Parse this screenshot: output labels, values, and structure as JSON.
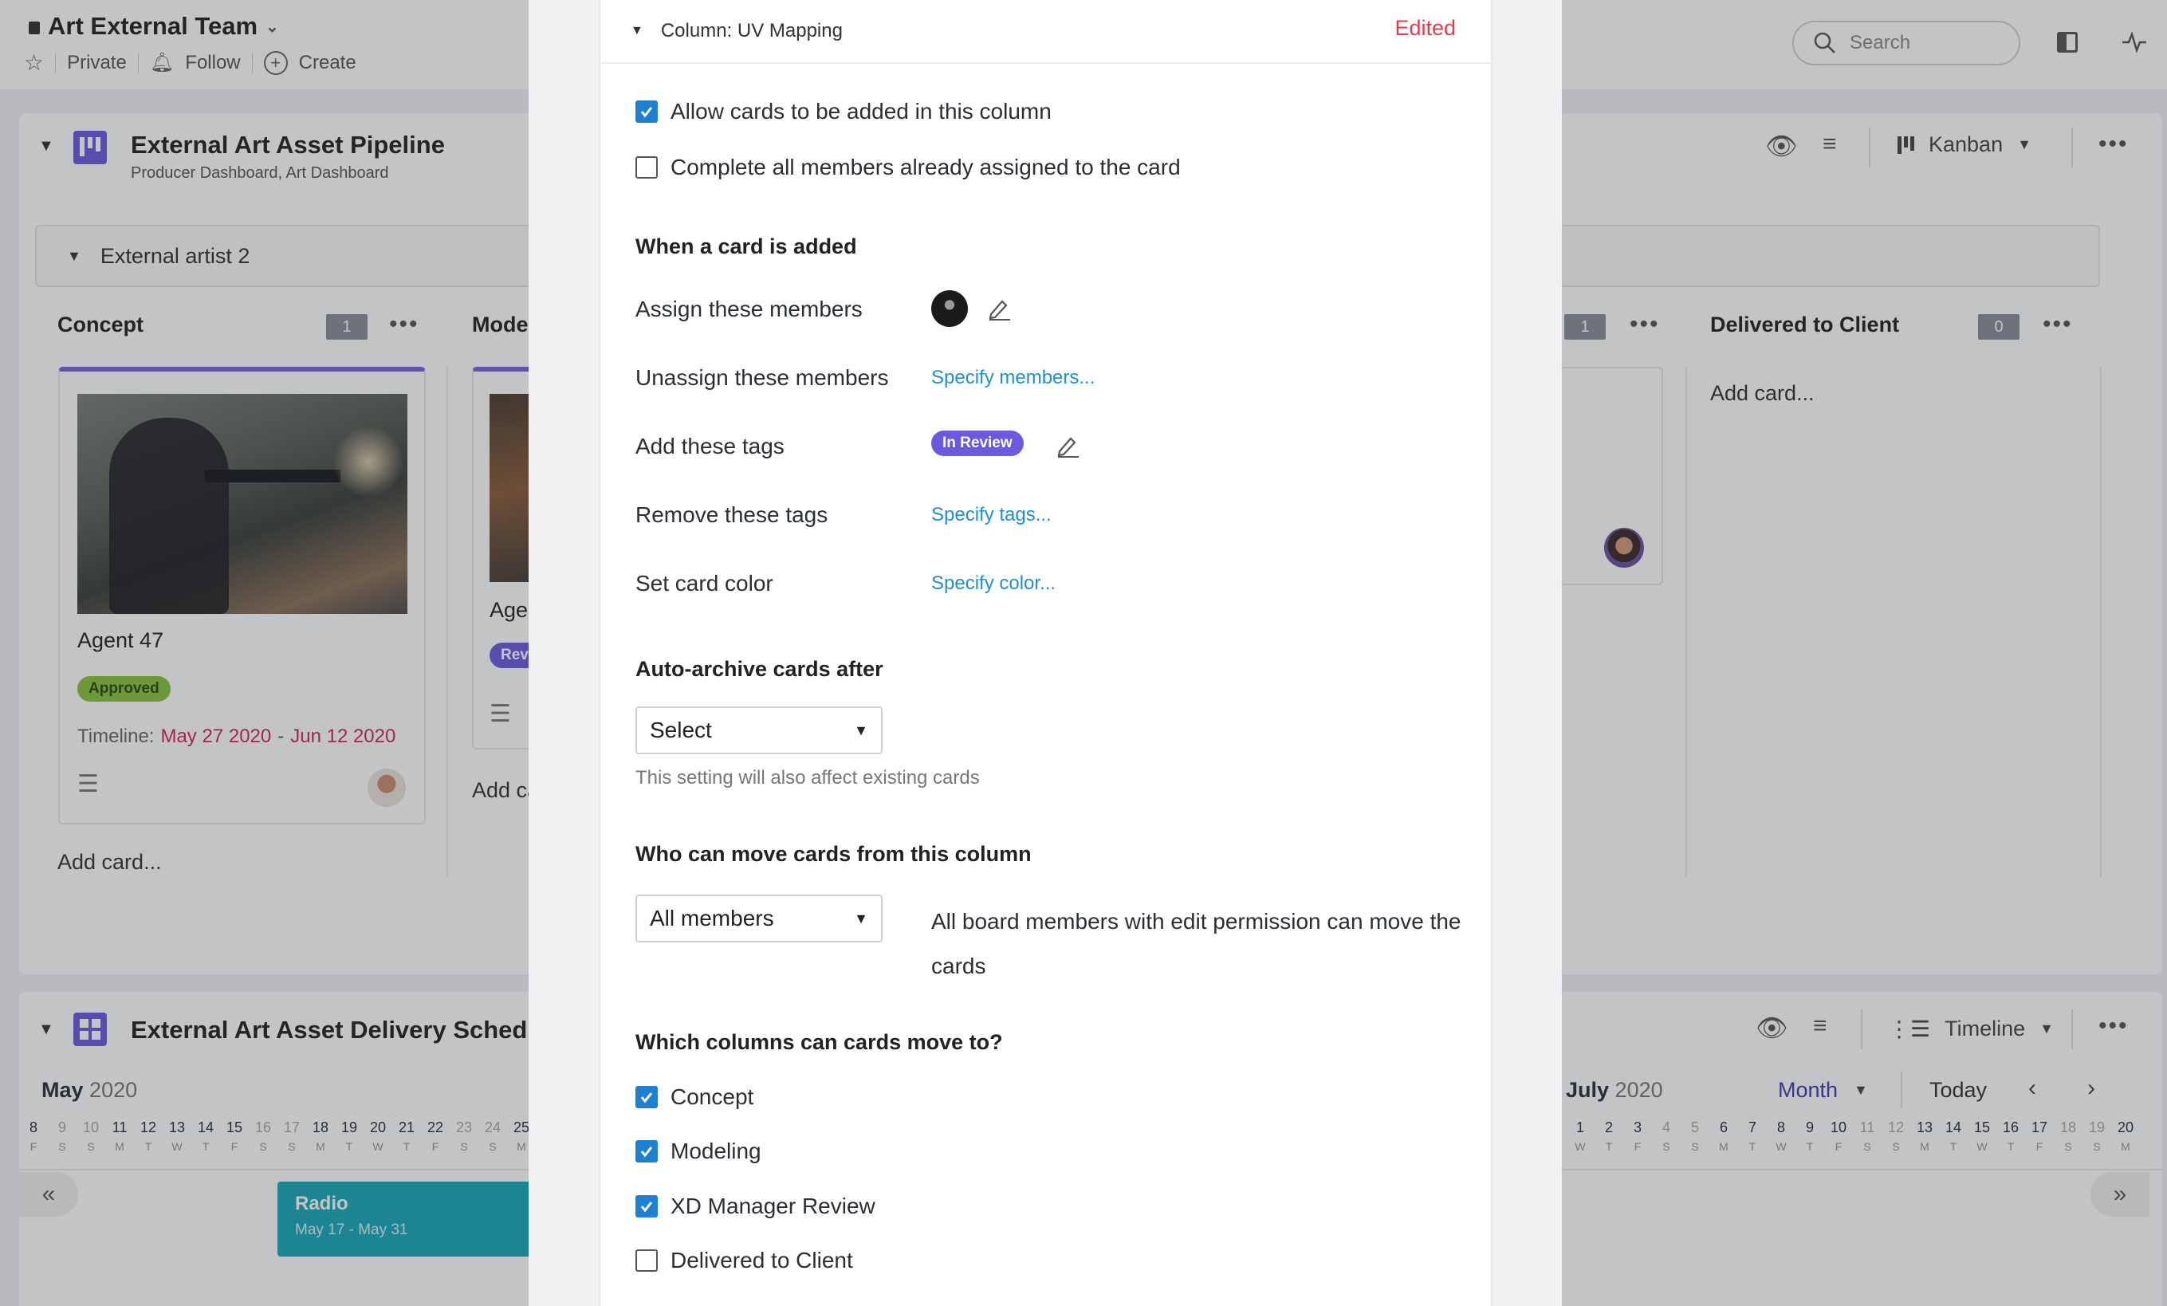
{
  "app": {
    "title": "Art External Team",
    "actions": {
      "private": "Private",
      "follow": "Follow",
      "create": "Create"
    },
    "search_placeholder": "Search"
  },
  "board1": {
    "title": "External Art Asset Pipeline",
    "subtitle": "Producer Dashboard, Art Dashboard",
    "view": "Kanban",
    "group": "External artist 2",
    "columns": [
      {
        "name": "Concept",
        "count": "1"
      },
      {
        "name": "Model"
      },
      {
        "name": "",
        "count": "1"
      },
      {
        "name": "Delivered to Client",
        "count": "0"
      }
    ],
    "concept_card": {
      "title": "Agent 47",
      "tag": "Approved",
      "timeline_label": "Timeline:",
      "timeline_start": "May 27 2020",
      "timeline_sep": "-",
      "timeline_end": "Jun 12 2020"
    },
    "model_card": {
      "title_partial": "Agen",
      "tag_partial": "Rev"
    },
    "add_card": "Add card...",
    "add_card_partial": "Add ca"
  },
  "board2": {
    "title": "External Art Asset Delivery Schedule",
    "view": "Timeline",
    "month_left": "May",
    "month_right": "July",
    "year": "2020",
    "scale": "Month",
    "today": "Today",
    "bar": {
      "title": "Radio",
      "dates": "May 17 - May 31"
    },
    "days_left": [
      {
        "n": "8",
        "d": "F"
      },
      {
        "n": "9",
        "d": "S"
      },
      {
        "n": "10",
        "d": "S"
      },
      {
        "n": "11",
        "d": "M"
      },
      {
        "n": "12",
        "d": "T"
      },
      {
        "n": "13",
        "d": "W"
      },
      {
        "n": "14",
        "d": "T"
      },
      {
        "n": "15",
        "d": "F"
      },
      {
        "n": "16",
        "d": "S"
      },
      {
        "n": "17",
        "d": "S"
      },
      {
        "n": "18",
        "d": "M"
      },
      {
        "n": "19",
        "d": "T"
      },
      {
        "n": "20",
        "d": "W"
      },
      {
        "n": "21",
        "d": "T"
      },
      {
        "n": "22",
        "d": "F"
      },
      {
        "n": "23",
        "d": "S"
      },
      {
        "n": "24",
        "d": "S"
      },
      {
        "n": "25",
        "d": "M"
      }
    ],
    "days_right": [
      {
        "n": "1",
        "d": "W"
      },
      {
        "n": "2",
        "d": "T"
      },
      {
        "n": "3",
        "d": "F"
      },
      {
        "n": "4",
        "d": "S"
      },
      {
        "n": "5",
        "d": "S"
      },
      {
        "n": "6",
        "d": "M"
      },
      {
        "n": "7",
        "d": "T"
      },
      {
        "n": "8",
        "d": "W"
      },
      {
        "n": "9",
        "d": "T"
      },
      {
        "n": "10",
        "d": "F"
      },
      {
        "n": "11",
        "d": "S"
      },
      {
        "n": "12",
        "d": "S"
      },
      {
        "n": "13",
        "d": "M"
      },
      {
        "n": "14",
        "d": "T"
      },
      {
        "n": "15",
        "d": "W"
      },
      {
        "n": "16",
        "d": "T"
      },
      {
        "n": "17",
        "d": "F"
      },
      {
        "n": "18",
        "d": "S"
      },
      {
        "n": "19",
        "d": "S"
      },
      {
        "n": "20",
        "d": "M"
      }
    ]
  },
  "modal": {
    "header": "Column: UV Mapping",
    "status": "Edited",
    "allow_add": "Allow cards to be added in this column",
    "complete_members": "Complete all members already assigned to the card",
    "when_added": "When a card is added",
    "assign": "Assign these members",
    "unassign": "Unassign these members",
    "unassign_link": "Specify members...",
    "add_tags": "Add these tags",
    "add_tag_value": "In Review",
    "remove_tags": "Remove these tags",
    "remove_tags_link": "Specify tags...",
    "card_color": "Set card color",
    "card_color_link": "Specify color...",
    "auto_archive": "Auto-archive cards after",
    "auto_archive_value": "Select",
    "auto_archive_hint": "This setting will also affect existing cards",
    "who_move": "Who can move cards from this column",
    "who_move_value": "All members",
    "who_move_desc": "All board members with edit permission can move the cards",
    "which_columns": "Which columns can cards move to?",
    "move_to": [
      {
        "label": "Concept",
        "checked": true
      },
      {
        "label": "Modeling",
        "checked": true
      },
      {
        "label": "XD Manager Review",
        "checked": true
      },
      {
        "label": "Delivered to Client",
        "checked": false
      }
    ]
  },
  "colors": {
    "accent": "#1f7fd1",
    "edited": "#e23c4f",
    "tag_review": "#6a5ae0",
    "tag_approved": "#8ac43f",
    "timeline_bar": "#1aa7b8"
  }
}
